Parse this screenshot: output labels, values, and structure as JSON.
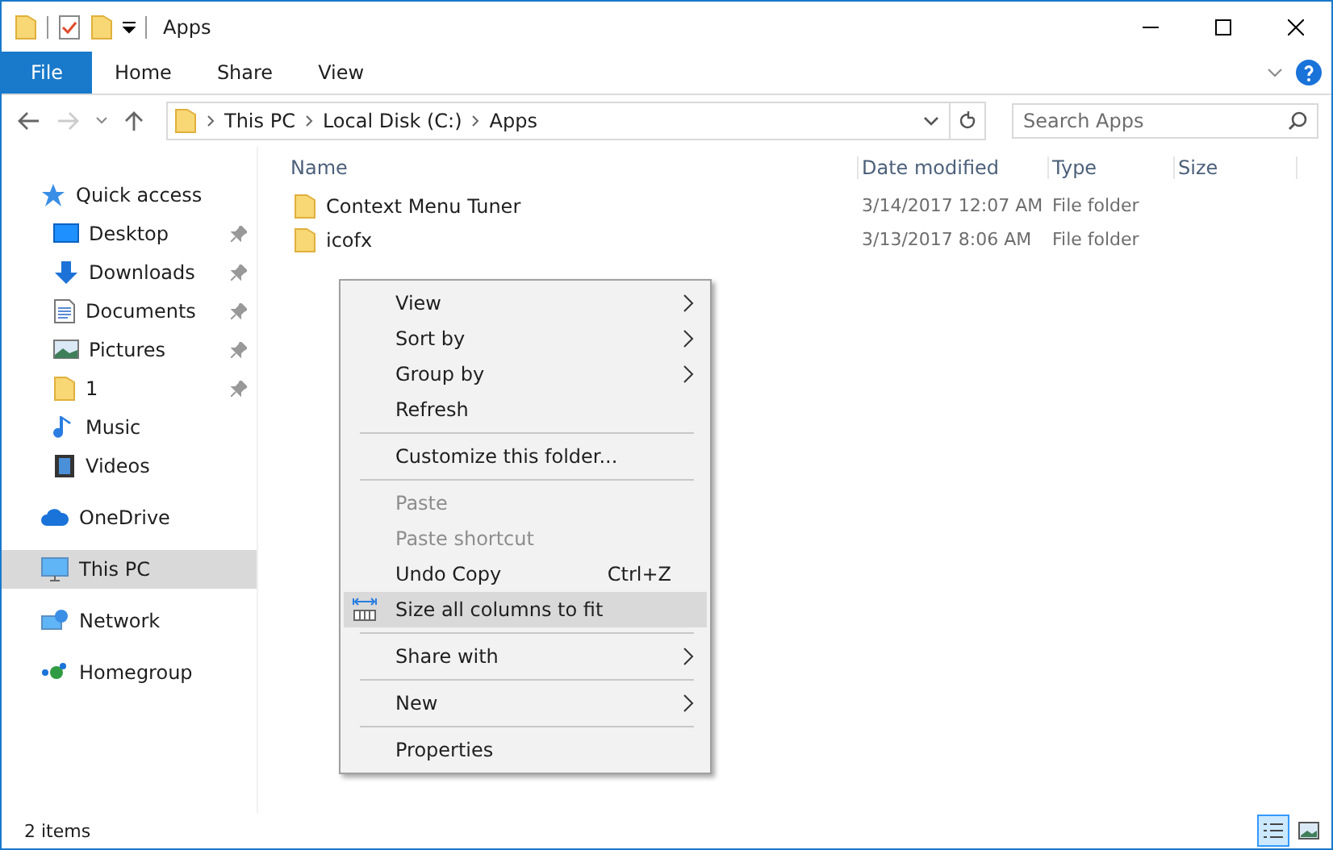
{
  "window": {
    "title": "Apps"
  },
  "ribbon_tabs": [
    {
      "label": "File",
      "kind": "file"
    },
    {
      "label": "Home",
      "kind": "tab"
    },
    {
      "label": "Share",
      "kind": "tab"
    },
    {
      "label": "View",
      "kind": "tab"
    }
  ],
  "breadcrumb": [
    "This PC",
    "Local Disk (C:)",
    "Apps"
  ],
  "search": {
    "placeholder": "Search Apps"
  },
  "sidebar": [
    {
      "label": "Quick access",
      "kind": "star",
      "selected": false,
      "children": [
        {
          "label": "Desktop",
          "kind": "desktop",
          "selected": false,
          "pinned": true
        },
        {
          "label": "Downloads",
          "kind": "download",
          "selected": false,
          "pinned": true
        },
        {
          "label": "Documents",
          "kind": "document",
          "selected": false,
          "pinned": true
        },
        {
          "label": "Pictures",
          "kind": "pictures",
          "selected": false,
          "pinned": true
        },
        {
          "label": "1",
          "kind": "folder",
          "selected": false,
          "pinned": true
        },
        {
          "label": "Music",
          "kind": "music",
          "selected": false,
          "pinned": false
        },
        {
          "label": "Videos",
          "kind": "video",
          "selected": false,
          "pinned": false
        }
      ]
    },
    {
      "label": "OneDrive",
      "kind": "cloud",
      "selected": false
    },
    {
      "label": "This PC",
      "kind": "pc",
      "selected": true
    },
    {
      "label": "Network",
      "kind": "network",
      "selected": false
    },
    {
      "label": "Homegroup",
      "kind": "homegroup",
      "selected": false
    }
  ],
  "table": {
    "columns": [
      "Name",
      "Date modified",
      "Type",
      "Size"
    ],
    "rows": [
      {
        "name": "Context Menu Tuner",
        "date": "3/14/2017 12:07 AM",
        "type": "File folder"
      },
      {
        "name": "icofx",
        "date": "3/13/2017 8:06 AM",
        "type": "File folder"
      }
    ]
  },
  "context_menu": [
    {
      "kind": "item",
      "label": "View",
      "submenu": true,
      "disabled": false,
      "selected": false
    },
    {
      "kind": "item",
      "label": "Sort by",
      "submenu": true,
      "disabled": false,
      "selected": false
    },
    {
      "kind": "item",
      "label": "Group by",
      "submenu": true,
      "disabled": false,
      "selected": false
    },
    {
      "kind": "item",
      "label": "Refresh",
      "submenu": false,
      "disabled": false,
      "selected": false
    },
    {
      "kind": "separator"
    },
    {
      "kind": "item",
      "label": "Customize this folder...",
      "submenu": false,
      "disabled": false,
      "selected": false
    },
    {
      "kind": "separator"
    },
    {
      "kind": "item",
      "label": "Paste",
      "submenu": false,
      "disabled": true,
      "selected": false
    },
    {
      "kind": "item",
      "label": "Paste shortcut",
      "submenu": false,
      "disabled": true,
      "selected": false
    },
    {
      "kind": "item",
      "label": "Undo Copy",
      "shortcut": "Ctrl+Z",
      "submenu": false,
      "disabled": false,
      "selected": false
    },
    {
      "kind": "columns",
      "label": "Size all columns to fit",
      "submenu": false,
      "disabled": false,
      "selected": true
    },
    {
      "kind": "separator"
    },
    {
      "kind": "item",
      "label": "Share with",
      "submenu": true,
      "disabled": false,
      "selected": false
    },
    {
      "kind": "separator"
    },
    {
      "kind": "item",
      "label": "New",
      "submenu": true,
      "disabled": false,
      "selected": false
    },
    {
      "kind": "separator"
    },
    {
      "kind": "item",
      "label": "Properties",
      "submenu": false,
      "disabled": false,
      "selected": false
    }
  ],
  "status_bar": {
    "text": "2 items",
    "view_buttons": [
      {
        "kind": "details",
        "selected": true
      },
      {
        "kind": "large_icons",
        "selected": false
      }
    ]
  }
}
